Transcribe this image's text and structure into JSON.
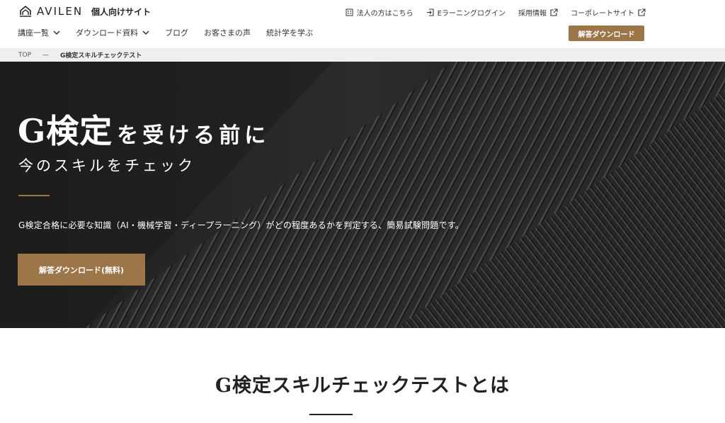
{
  "brand": {
    "name": "AVILEN",
    "subtitle": "個人向けサイト"
  },
  "util_nav": [
    {
      "label": "法人の方はこちら",
      "icon": "building-icon"
    },
    {
      "label": "Eラーニングログイン",
      "icon": "login-icon"
    },
    {
      "label": "採用情報",
      "icon": "external-link-icon"
    },
    {
      "label": "コーポレートサイト",
      "icon": "external-link-icon"
    }
  ],
  "main_nav": [
    {
      "label": "講座一覧",
      "dropdown": true
    },
    {
      "label": "ダウンロード資料",
      "dropdown": true
    },
    {
      "label": "ブログ",
      "dropdown": false
    },
    {
      "label": "お客さまの声",
      "dropdown": false
    },
    {
      "label": "統計学を学ぶ",
      "dropdown": false
    }
  ],
  "header_cta": "解答ダウンロード",
  "breadcrumb": {
    "home": "TOP",
    "separator": "—",
    "current": "G検定スキルチェックテスト"
  },
  "hero": {
    "title_main": "G検定",
    "title_sub": "を受ける前に",
    "subtitle": "今のスキルをチェック",
    "description": "G検定合格に必要な知識（AI・機械学習・ディープラーニング）がどの程度あるかを判定する、簡易試験問題です。",
    "cta": "解答ダウンロード(無料)"
  },
  "section": {
    "title": "G検定スキルチェックテストとは"
  },
  "colors": {
    "accent": "#9c7548",
    "hero_bg": "#262626",
    "breadcrumb_bg": "#efefef"
  }
}
